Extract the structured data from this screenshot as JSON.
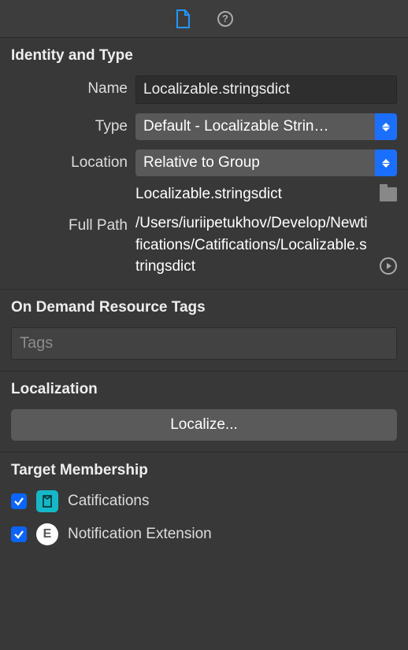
{
  "identity": {
    "section_title": "Identity and Type",
    "name_label": "Name",
    "name_value": "Localizable.stringsdict",
    "type_label": "Type",
    "type_value": "Default - Localizable Strin…",
    "location_label": "Location",
    "location_value": "Relative to Group",
    "location_file": "Localizable.stringsdict",
    "full_path_label": "Full Path",
    "full_path_value": "/Users/iuriipetukhov/Develop/Newtifications/Catifications/Localizable.stringsdict"
  },
  "resource_tags": {
    "section_title": "On Demand Resource Tags",
    "placeholder": "Tags"
  },
  "localization": {
    "section_title": "Localization",
    "button": "Localize..."
  },
  "targets": {
    "section_title": "Target Membership",
    "items": [
      {
        "label": "Catifications",
        "checked": true,
        "icon_kind": "teal",
        "icon_glyph": ""
      },
      {
        "label": "Notification Extension",
        "checked": true,
        "icon_kind": "white",
        "icon_glyph": "E"
      }
    ]
  }
}
